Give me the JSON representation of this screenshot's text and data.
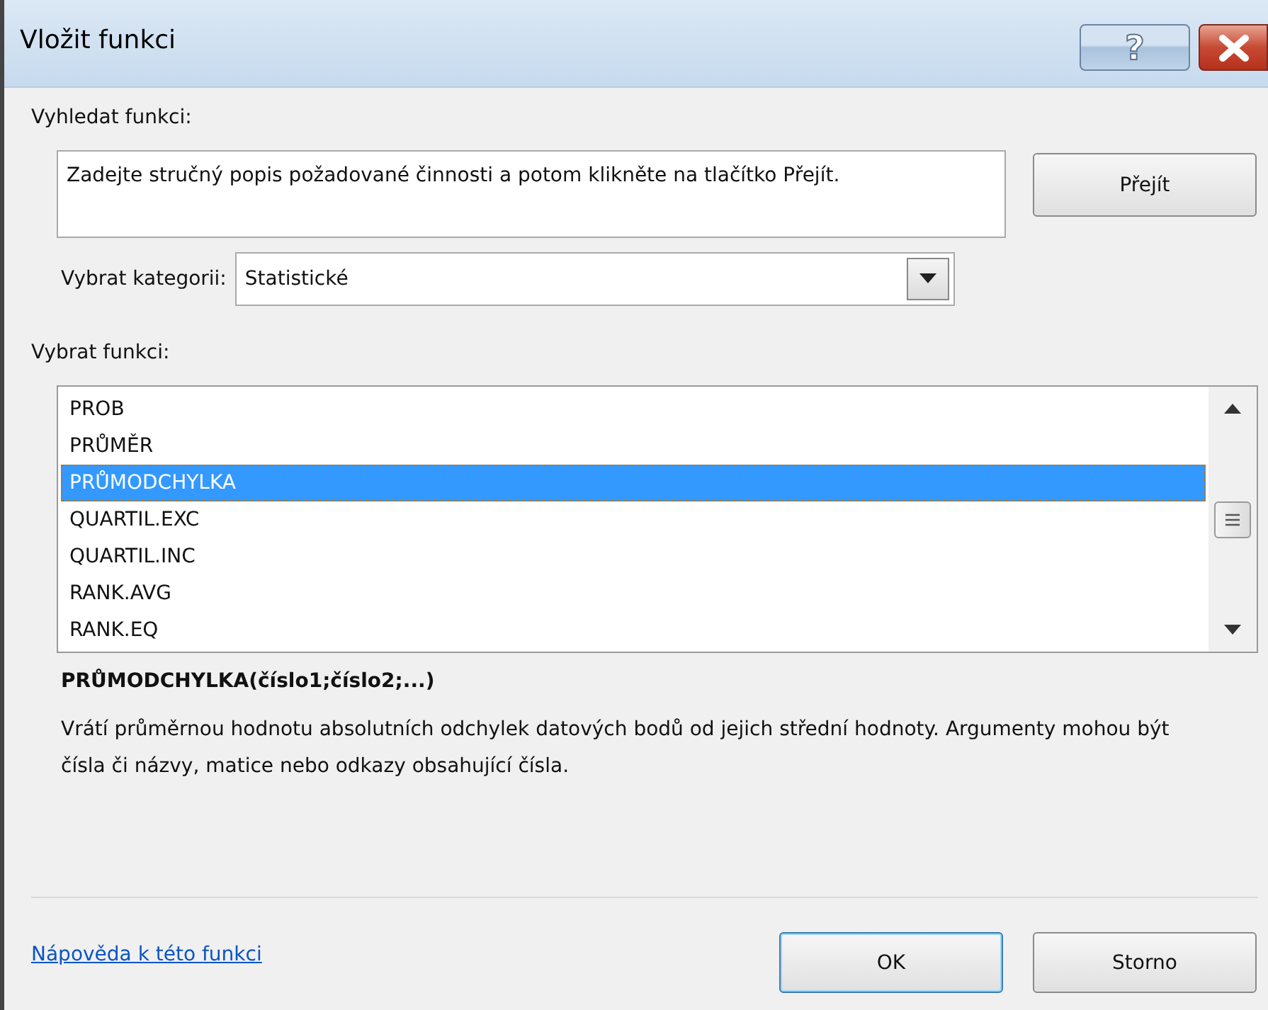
{
  "window": {
    "title": "Vložit funkci",
    "help_button": "?"
  },
  "search": {
    "label": "Vyhledat funkci:",
    "value": "Zadejte stručný popis požadované činnosti a potom klikněte na tlačítko Přejít.",
    "go_button": "Přejít"
  },
  "category": {
    "label": "Vybrat kategorii:",
    "value": "Statistické"
  },
  "functions": {
    "label": "Vybrat funkci:",
    "items": [
      {
        "name": "PROB",
        "selected": false
      },
      {
        "name": "PRŮMĚR",
        "selected": false
      },
      {
        "name": "PRŮMODCHYLKA",
        "selected": true
      },
      {
        "name": "QUARTIL.EXC",
        "selected": false
      },
      {
        "name": "QUARTIL.INC",
        "selected": false
      },
      {
        "name": "RANK.AVG",
        "selected": false
      },
      {
        "name": "RANK.EQ",
        "selected": false
      }
    ]
  },
  "signature": "PRŮMODCHYLKA(číslo1;číslo2;...)",
  "description": "Vrátí průměrnou hodnotu absolutních odchylek datových bodů od jejich střední hodnoty. Argumenty mohou být čísla či názvy, matice nebo odkazy obsahující čísla.",
  "help_link": "Nápověda k této funkci",
  "buttons": [
    "OK",
    "Storno"
  ]
}
